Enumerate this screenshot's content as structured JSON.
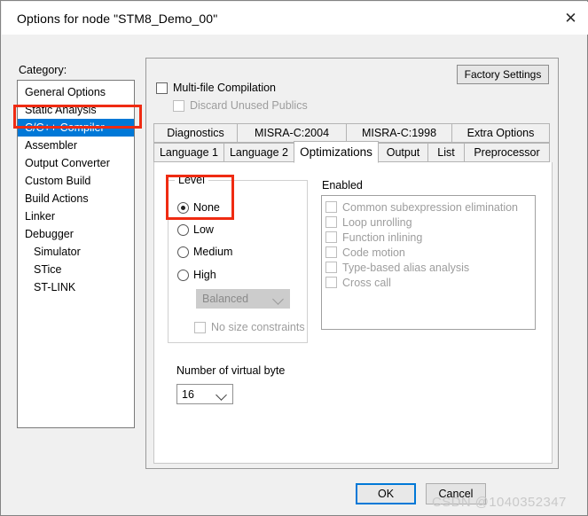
{
  "window": {
    "title": "Options for node \"STM8_Demo_00\"",
    "close_icon": "close-icon"
  },
  "sidebar": {
    "label": "Category:",
    "items": [
      {
        "label": "General Options",
        "selected": false,
        "indent": false
      },
      {
        "label": "Static Analysis",
        "selected": false,
        "indent": false
      },
      {
        "label": "C/C++ Compiler",
        "selected": true,
        "indent": false
      },
      {
        "label": "Assembler",
        "selected": false,
        "indent": false
      },
      {
        "label": "Output Converter",
        "selected": false,
        "indent": false
      },
      {
        "label": "Custom Build",
        "selected": false,
        "indent": false
      },
      {
        "label": "Build Actions",
        "selected": false,
        "indent": false
      },
      {
        "label": "Linker",
        "selected": false,
        "indent": false
      },
      {
        "label": "Debugger",
        "selected": false,
        "indent": false
      },
      {
        "label": "Simulator",
        "selected": false,
        "indent": true
      },
      {
        "label": "STice",
        "selected": false,
        "indent": true
      },
      {
        "label": "ST-LINK",
        "selected": false,
        "indent": true
      }
    ]
  },
  "main": {
    "factory_settings_label": "Factory Settings",
    "multi_file_compilation": {
      "label": "Multi-file Compilation",
      "checked": false,
      "disabled": false
    },
    "discard_unused_publics": {
      "label": "Discard Unused Publics",
      "checked": false,
      "disabled": true
    },
    "tabs_row1": [
      {
        "label": "Diagnostics",
        "active": false
      },
      {
        "label": "MISRA-C:2004",
        "active": false
      },
      {
        "label": "MISRA-C:1998",
        "active": false
      },
      {
        "label": "Extra Options",
        "active": false
      }
    ],
    "tabs_row2": [
      {
        "label": "Language 1",
        "active": false
      },
      {
        "label": "Language 2",
        "active": false
      },
      {
        "label": "Optimizations",
        "active": true
      },
      {
        "label": "Output",
        "active": false
      },
      {
        "label": "List",
        "active": false
      },
      {
        "label": "Preprocessor",
        "active": false
      }
    ],
    "level_group": {
      "legend": "Level",
      "options": [
        {
          "label": "None",
          "selected": true
        },
        {
          "label": "Low",
          "selected": false
        },
        {
          "label": "Medium",
          "selected": false
        },
        {
          "label": "High",
          "selected": false
        }
      ],
      "strategy_combo": {
        "value": "Balanced",
        "disabled": true
      },
      "no_size_constraints": {
        "label": "No size constraints",
        "checked": false,
        "disabled": true
      }
    },
    "enabled_group": {
      "label": "Enabled",
      "items": [
        {
          "label": "Common subexpression elimination",
          "checked": false,
          "disabled": true
        },
        {
          "label": "Loop unrolling",
          "checked": false,
          "disabled": true
        },
        {
          "label": "Function inlining",
          "checked": false,
          "disabled": true
        },
        {
          "label": "Code motion",
          "checked": false,
          "disabled": true
        },
        {
          "label": "Type-based alias analysis",
          "checked": false,
          "disabled": true
        },
        {
          "label": "Cross call",
          "checked": false,
          "disabled": true
        }
      ]
    },
    "virtual_bytes": {
      "label": "Number of virtual byte",
      "value": "16"
    }
  },
  "footer": {
    "ok_label": "OK",
    "cancel_label": "Cancel"
  },
  "overlay": {
    "watermark": "CSDN @1040352347",
    "annotation_color": "#ef2b12"
  }
}
